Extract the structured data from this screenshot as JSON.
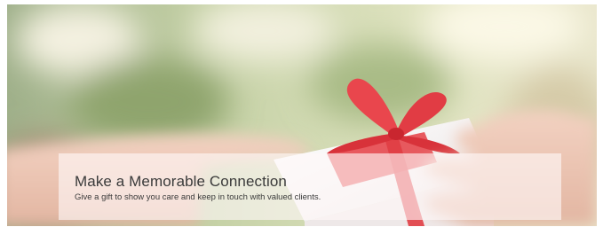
{
  "banner": {
    "image_icon": "gift-handover-photo",
    "title": "Make a Memorable Connection",
    "subtitle": "Give a gift to show you care and keep in touch with valued clients."
  }
}
